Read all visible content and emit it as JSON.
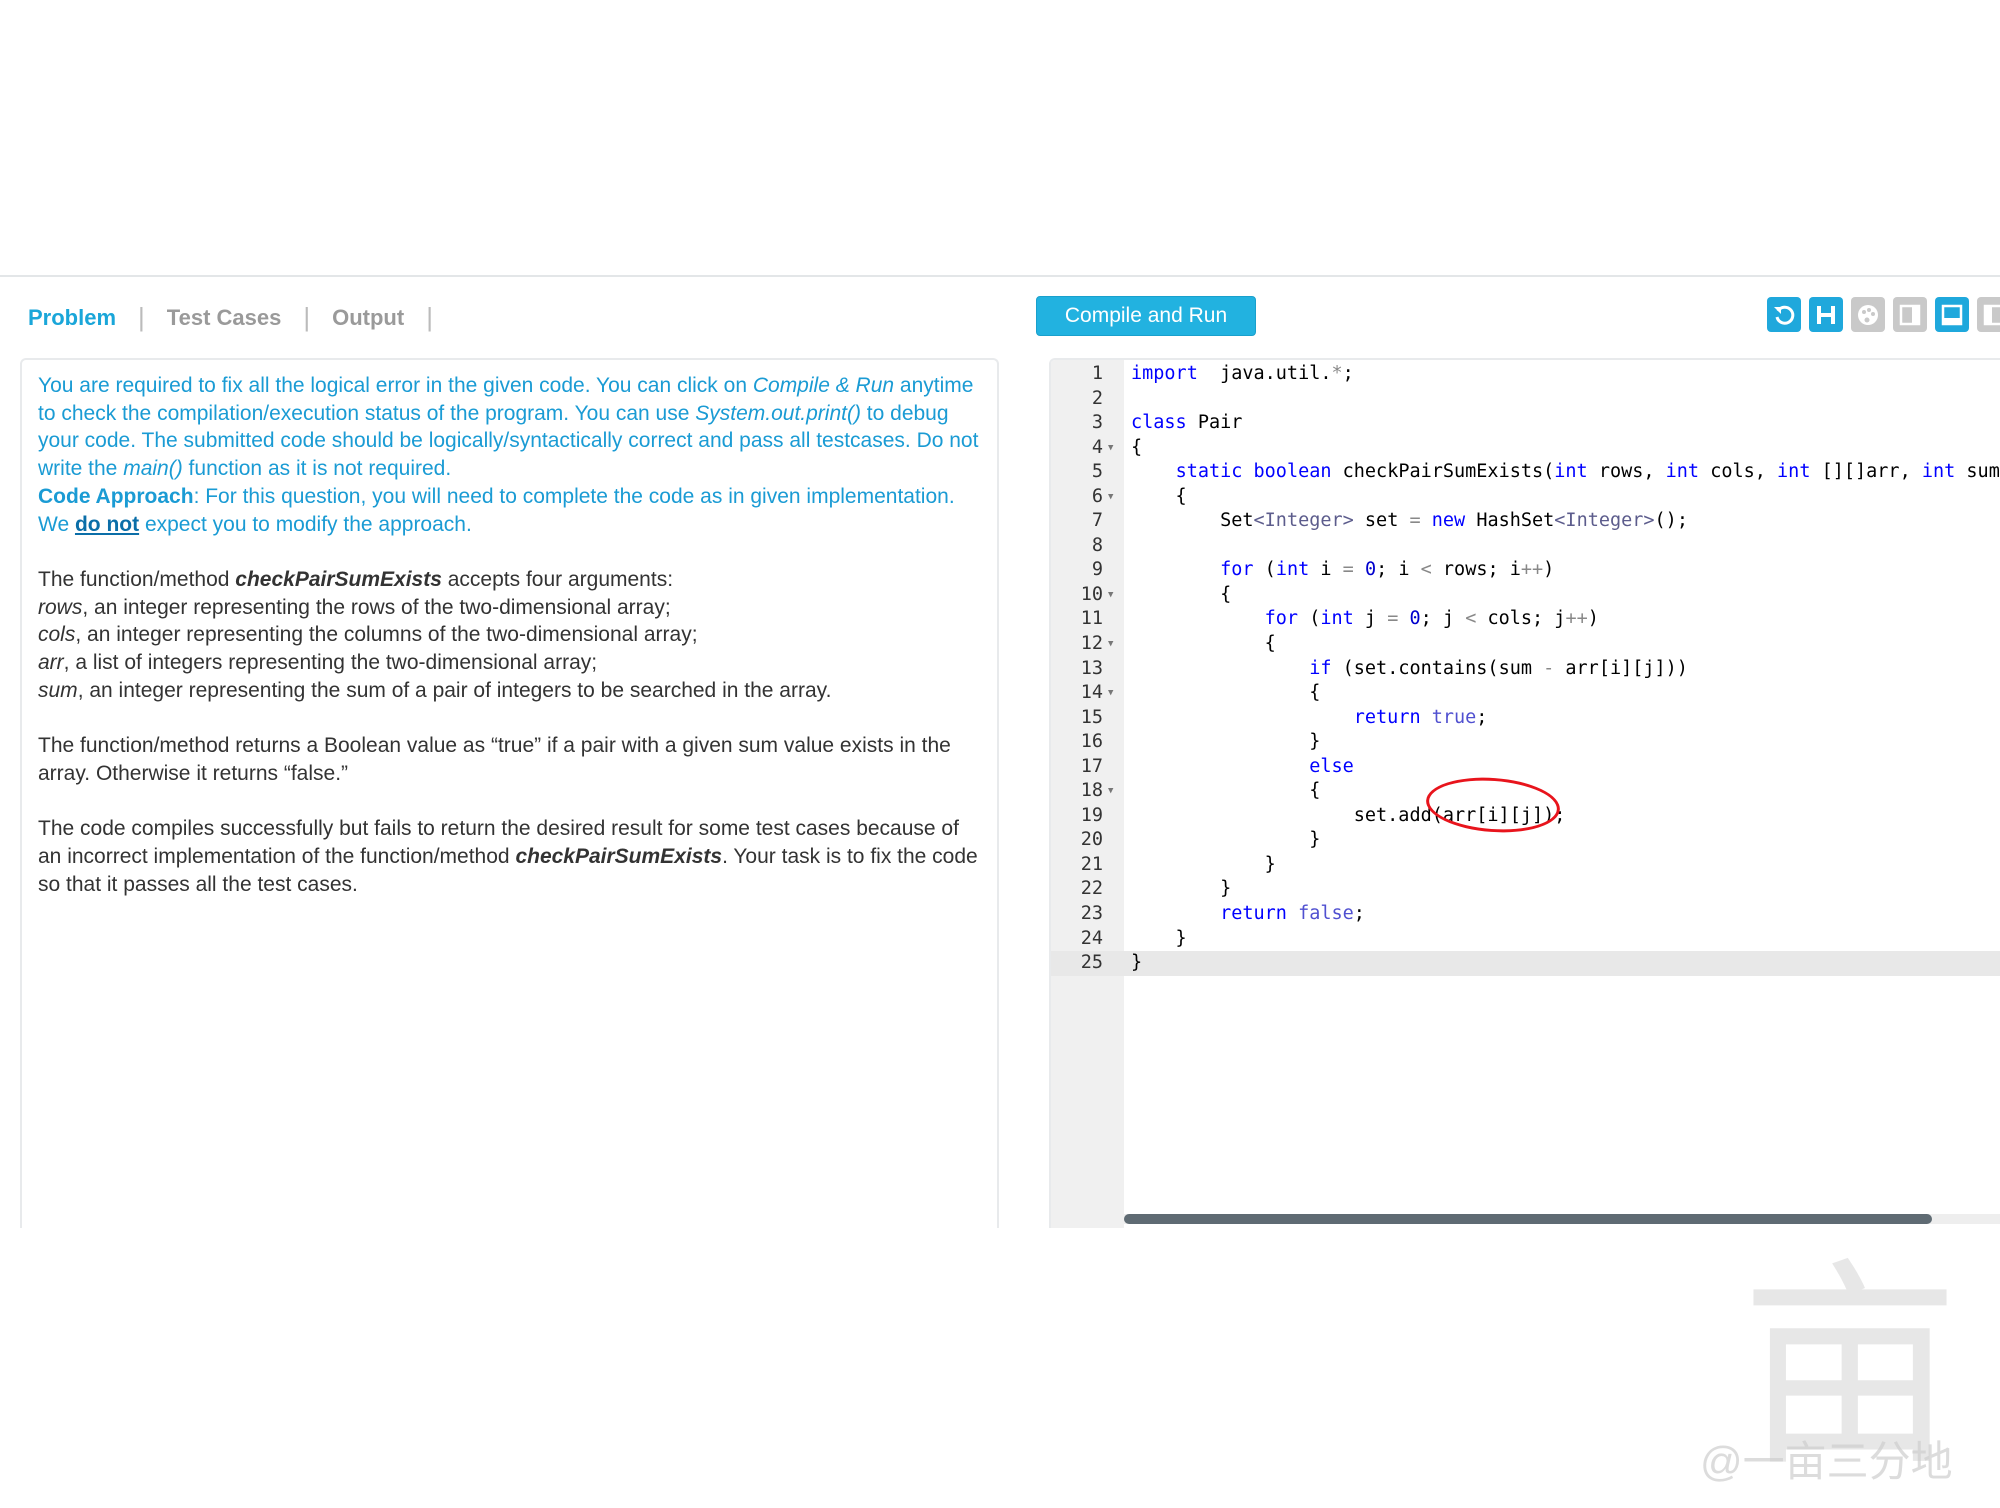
{
  "tabs": [
    {
      "label": "Problem",
      "active": true
    },
    {
      "label": "Test Cases",
      "active": false
    },
    {
      "label": "Output",
      "active": false
    }
  ],
  "separator": "|",
  "compile_button": "Compile and Run",
  "toolbar": {
    "icons": [
      "reset-icon",
      "save-icon",
      "theme-palette-icon",
      "layout-right-icon",
      "layout-bottom-icon",
      "layout-left-icon"
    ],
    "accent": "#1fa8dc",
    "inactive": "#c9c9c9"
  },
  "description": {
    "p1": [
      [
        "t",
        "You are required to fix all the logical error in the given code. You can click on "
      ],
      [
        "i",
        "Compile & Run"
      ],
      [
        "t",
        " anytime to check the compilation/execution status of the program. You can use "
      ],
      [
        "i",
        "System.out.print()"
      ],
      [
        "t",
        " to debug your code. The submitted code should be logically/syntactically correct and pass all testcases. Do not write the "
      ],
      [
        "i",
        "main()"
      ],
      [
        "t",
        " function as it is not required."
      ]
    ],
    "p2": [
      [
        "b",
        "Code Approach"
      ],
      [
        "t",
        ": For this question, you will need to complete the code as in given implementation. We "
      ],
      [
        "a",
        "do not"
      ],
      [
        "t",
        " expect you to modify the approach."
      ]
    ],
    "p3": [
      [
        "t",
        "The function/method "
      ],
      [
        "bi",
        "checkPairSumExists"
      ],
      [
        "t",
        " accepts four arguments:"
      ],
      [
        "br",
        ""
      ],
      [
        "i",
        "rows"
      ],
      [
        "t",
        ", an integer representing the rows of the two-dimensional array;"
      ],
      [
        "br",
        ""
      ],
      [
        "i",
        "cols"
      ],
      [
        "t",
        ", an integer representing the columns of the two-dimensional array;"
      ],
      [
        "br",
        ""
      ],
      [
        "i",
        "arr"
      ],
      [
        "t",
        ", a list of integers representing the two-dimensional array;"
      ],
      [
        "br",
        ""
      ],
      [
        "i",
        "sum"
      ],
      [
        "t",
        ", an integer representing the sum of a pair of integers to be searched in the array."
      ]
    ],
    "p4": [
      [
        "t",
        "The function/method returns a Boolean value as “true” if a pair with a given sum value exists in the array. Otherwise it returns “false.”"
      ]
    ],
    "p5": [
      [
        "t",
        "The code compiles successfully but fails to return the desired result for some test cases because of an incorrect implementation of the function/method "
      ],
      [
        "bi",
        "checkPairSumExists"
      ],
      [
        "t",
        ". Your task is to fix the code so that it passes all the test cases."
      ]
    ]
  },
  "editor": {
    "active_line": 25,
    "fold_lines": [
      4,
      6,
      10,
      12,
      14,
      18
    ],
    "lines": [
      [
        [
          "kw",
          "import"
        ],
        [
          "",
          "  java.util."
        ],
        [
          "op",
          "*"
        ],
        [
          "",
          ";"
        ]
      ],
      [],
      [
        [
          "kw",
          "class"
        ],
        [
          "",
          " Pair"
        ]
      ],
      [
        [
          "",
          "{"
        ]
      ],
      [
        [
          "",
          "    "
        ],
        [
          "kw",
          "static"
        ],
        [
          "",
          " "
        ],
        [
          "ty",
          "boolean"
        ],
        [
          "",
          " checkPairSumExists("
        ],
        [
          "ty",
          "int"
        ],
        [
          "",
          " rows, "
        ],
        [
          "ty",
          "int"
        ],
        [
          "",
          " cols, "
        ],
        [
          "ty",
          "int"
        ],
        [
          "",
          " [][]arr, "
        ],
        [
          "ty",
          "int"
        ],
        [
          "",
          " sum)"
        ]
      ],
      [
        [
          "",
          "    {"
        ]
      ],
      [
        [
          "",
          "        Set"
        ],
        [
          "gen",
          "<Integer>"
        ],
        [
          "",
          " set "
        ],
        [
          "op",
          "="
        ],
        [
          "",
          " "
        ],
        [
          "kw",
          "new"
        ],
        [
          "",
          " HashSet"
        ],
        [
          "gen",
          "<Integer>"
        ],
        [
          "",
          "();"
        ]
      ],
      [],
      [
        [
          "",
          "        "
        ],
        [
          "kw",
          "for"
        ],
        [
          "",
          " ("
        ],
        [
          "ty",
          "int"
        ],
        [
          "",
          " i "
        ],
        [
          "op",
          "="
        ],
        [
          "",
          " "
        ],
        [
          "num0",
          "0"
        ],
        [
          "",
          "; i "
        ],
        [
          "op",
          "<"
        ],
        [
          "",
          " rows; i"
        ],
        [
          "op",
          "++"
        ],
        [
          "",
          ")"
        ]
      ],
      [
        [
          "",
          "        {"
        ]
      ],
      [
        [
          "",
          "            "
        ],
        [
          "kw",
          "for"
        ],
        [
          "",
          " ("
        ],
        [
          "ty",
          "int"
        ],
        [
          "",
          " j "
        ],
        [
          "op",
          "="
        ],
        [
          "",
          " "
        ],
        [
          "num0",
          "0"
        ],
        [
          "",
          "; j "
        ],
        [
          "op",
          "<"
        ],
        [
          "",
          " cols; j"
        ],
        [
          "op",
          "++"
        ],
        [
          "",
          ")"
        ]
      ],
      [
        [
          "",
          "            {"
        ]
      ],
      [
        [
          "",
          "                "
        ],
        [
          "kw",
          "if"
        ],
        [
          "",
          " (set.contains(sum "
        ],
        [
          "op",
          "-"
        ],
        [
          "",
          " arr[i][j]))"
        ]
      ],
      [
        [
          "",
          "                {"
        ]
      ],
      [
        [
          "",
          "                    "
        ],
        [
          "kw",
          "return"
        ],
        [
          "",
          " "
        ],
        [
          "lit",
          "true"
        ],
        [
          "",
          ";"
        ]
      ],
      [
        [
          "",
          "                }"
        ]
      ],
      [
        [
          "",
          "                "
        ],
        [
          "kw",
          "else"
        ]
      ],
      [
        [
          "",
          "                {"
        ]
      ],
      [
        [
          "",
          "                    set.add(arr[i][j]);"
        ]
      ],
      [
        [
          "",
          "                }"
        ]
      ],
      [
        [
          "",
          "            }"
        ]
      ],
      [
        [
          "",
          "        }"
        ]
      ],
      [
        [
          "",
          "        "
        ],
        [
          "kw",
          "return"
        ],
        [
          "",
          " "
        ],
        [
          "lit",
          "false"
        ],
        [
          "",
          ";"
        ]
      ],
      [
        [
          "",
          "    }"
        ]
      ],
      [
        [
          "",
          "}"
        ]
      ]
    ],
    "annotation_color": "#e8141c"
  },
  "watermark": "@一亩三分地"
}
